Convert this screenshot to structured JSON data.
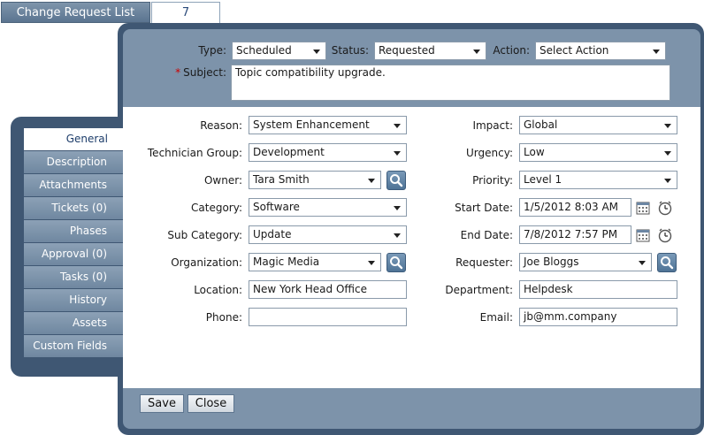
{
  "topbar": {
    "list_button": "Change Request List",
    "count": "7"
  },
  "header": {
    "type": {
      "label": "Type:",
      "value": "Scheduled"
    },
    "status": {
      "label": "Status:",
      "value": "Requested"
    },
    "action": {
      "label": "Action:",
      "value": "Select Action"
    },
    "subject": {
      "required_mark": "*",
      "label": "Subject:",
      "value": "Topic compatibility upgrade."
    }
  },
  "sidebar": {
    "items": [
      {
        "label": "General"
      },
      {
        "label": "Description"
      },
      {
        "label": "Attachments"
      },
      {
        "label": "Tickets (0)"
      },
      {
        "label": "Phases"
      },
      {
        "label": "Approval (0)"
      },
      {
        "label": "Tasks (0)"
      },
      {
        "label": "History"
      },
      {
        "label": "Assets"
      },
      {
        "label": "Custom Fields"
      }
    ]
  },
  "form": {
    "left": {
      "reason": {
        "label": "Reason:",
        "value": "System Enhancement"
      },
      "technician_group": {
        "label": "Technician Group:",
        "value": "Development"
      },
      "owner": {
        "label": "Owner:",
        "value": "Tara Smith"
      },
      "category": {
        "label": "Category:",
        "value": "Software"
      },
      "sub_category": {
        "label": "Sub Category:",
        "value": "Update"
      },
      "organization": {
        "label": "Organization:",
        "value": "Magic Media"
      },
      "location": {
        "label": "Location:",
        "value": "New York Head Office"
      },
      "phone": {
        "label": "Phone:",
        "value": ""
      }
    },
    "right": {
      "impact": {
        "label": "Impact:",
        "value": "Global"
      },
      "urgency": {
        "label": "Urgency:",
        "value": "Low"
      },
      "priority": {
        "label": "Priority:",
        "value": "Level 1"
      },
      "start_date": {
        "label": "Start Date:",
        "value": "1/5/2012 8:03 AM"
      },
      "end_date": {
        "label": "End Date:",
        "value": "7/8/2012 7:57 PM"
      },
      "requester": {
        "label": "Requester:",
        "value": "Joe Bloggs"
      },
      "department": {
        "label": "Department:",
        "value": "Helpdesk"
      },
      "email": {
        "label": "Email:",
        "value": "jb@mm.company"
      }
    }
  },
  "footer": {
    "save_label": "Save",
    "close_label": "Close"
  },
  "colors": {
    "panel_dark": "#3f5773",
    "panel_light": "#7d93aa",
    "required": "#cc0000",
    "active_tab_text": "#1d3d6a"
  },
  "icons": [
    "search-icon",
    "calendar-icon",
    "clock-icon",
    "chevron-down-icon"
  ]
}
